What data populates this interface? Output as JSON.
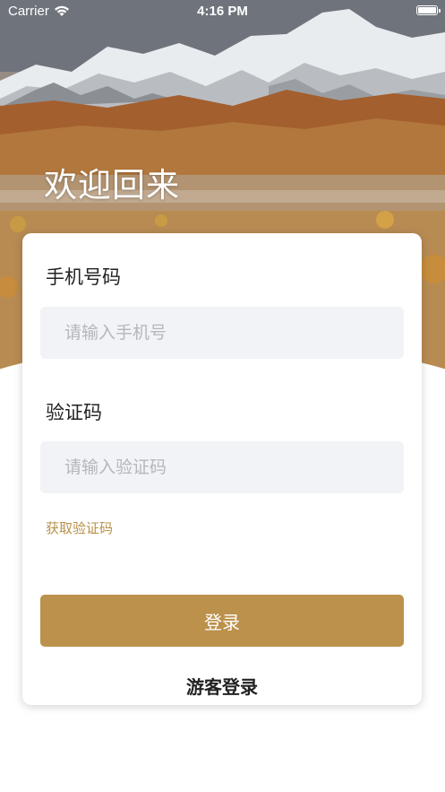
{
  "status_bar": {
    "carrier": "Carrier",
    "time": "4:16 PM",
    "wifi_icon": "wifi-icon",
    "battery_icon": "battery-icon"
  },
  "header": {
    "title": "欢迎回来",
    "background": "snowy-mountain-landscape"
  },
  "form": {
    "phone_label": "手机号码",
    "phone_placeholder": "请输入手机号",
    "phone_value": "",
    "code_label": "验证码",
    "code_placeholder": "请输入验证码",
    "code_value": "",
    "get_code_label": "获取验证码",
    "login_label": "登录",
    "guest_login_label": "游客登录"
  },
  "colors": {
    "accent": "#bc914b",
    "input_background": "#f2f3f6",
    "text_primary": "#222222",
    "placeholder": "#b5b7bc"
  }
}
